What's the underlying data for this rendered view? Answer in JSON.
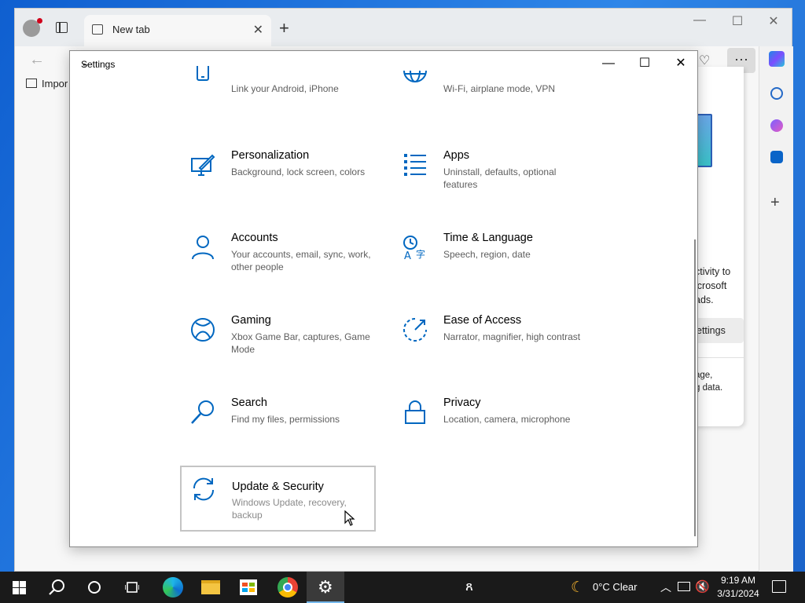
{
  "browser": {
    "tab_label": "New tab",
    "bookmark_label": "Impor",
    "more_label": "···",
    "panel_lines": [
      "ctivity to",
      "icrosoft",
      "ads."
    ],
    "panel_button": "ettings",
    "panel_lines2": [
      "age,",
      "g data."
    ]
  },
  "settings": {
    "title": "Settings",
    "tiles": [
      {
        "title": "",
        "desc": "Link your Android, iPhone"
      },
      {
        "title": "",
        "desc": "Wi-Fi, airplane mode, VPN"
      },
      {
        "title": "Personalization",
        "desc": "Background, lock screen, colors"
      },
      {
        "title": "Apps",
        "desc": "Uninstall, defaults, optional features"
      },
      {
        "title": "Accounts",
        "desc": "Your accounts, email, sync, work, other people"
      },
      {
        "title": "Time & Language",
        "desc": "Speech, region, date"
      },
      {
        "title": "Gaming",
        "desc": "Xbox Game Bar, captures, Game Mode"
      },
      {
        "title": "Ease of Access",
        "desc": "Narrator, magnifier, high contrast"
      },
      {
        "title": "Search",
        "desc": "Find my files, permissions"
      },
      {
        "title": "Privacy",
        "desc": "Location, camera, microphone"
      },
      {
        "title": "Update & Security",
        "desc": "Windows Update, recovery, backup"
      }
    ]
  },
  "taskbar": {
    "weather": "0°C  Clear",
    "time": "9:19 AM",
    "date": "3/31/2024"
  },
  "colors": {
    "accent": "#0067c0",
    "taskbar": "#1a1a1a"
  }
}
